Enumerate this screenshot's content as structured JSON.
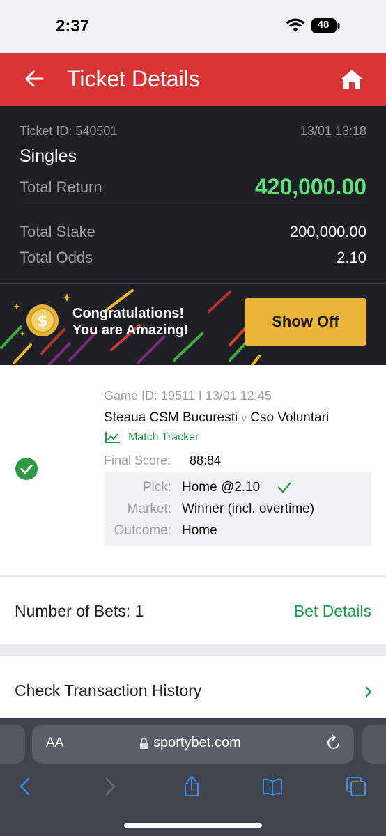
{
  "status_bar": {
    "time": "2:37",
    "battery": "48"
  },
  "header": {
    "title": "Ticket Details"
  },
  "summary": {
    "ticket_id": "Ticket ID: 540501",
    "date": "13/01 13:18",
    "type": "Singles",
    "total_return_label": "Total Return",
    "total_return_value": "420,000.00",
    "total_stake_label": "Total Stake",
    "total_stake_value": "200,000.00",
    "total_odds_label": "Total Odds",
    "total_odds_value": "2.10"
  },
  "banner": {
    "line1": "Congratulations!",
    "line2": "You are Amazing!",
    "button": "Show Off"
  },
  "game": {
    "game_id": "Game ID: 19511 I 13/01 12:45",
    "home_team": "Steaua CSM Bucuresti",
    "vs": "v",
    "away_team": "Cso Voluntari",
    "tracker": "Match Tracker",
    "final_score_label": "Final Score:",
    "final_score_value": "88:84",
    "pick_label": "Pick:",
    "pick_value": "Home @2.10",
    "market_label": "Market:",
    "market_value": "Winner (incl. overtime)",
    "outcome_label": "Outcome:",
    "outcome_value": "Home"
  },
  "bets": {
    "label": "Number of Bets: 1",
    "details": "Bet Details"
  },
  "history": {
    "label": "Check Transaction History"
  },
  "browser": {
    "aa": "AA",
    "url": "sportybet.com"
  },
  "colors": {
    "header_red": "#d93434",
    "return_green": "#5fe07a",
    "accent_green": "#1f9a47",
    "button_gold": "#ebb43a",
    "dark_bg": "#1f2025"
  }
}
